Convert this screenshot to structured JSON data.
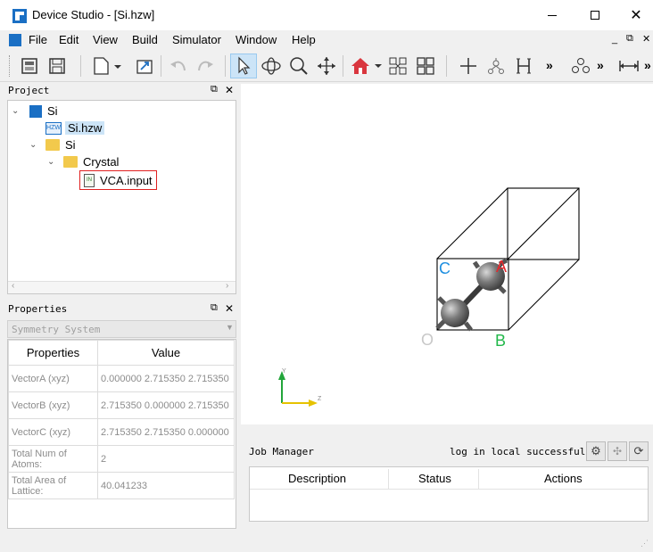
{
  "window": {
    "title": "Device Studio - [Si.hzw]"
  },
  "menu": [
    "File",
    "Edit",
    "View",
    "Build",
    "Simulator",
    "Window",
    "Help"
  ],
  "toolbar": {
    "icons": [
      "new-project-icon",
      "save-icon",
      "new-file-icon",
      "import-icon",
      "undo-icon",
      "redo-icon",
      "select-arrow-icon",
      "rotate-icon",
      "zoom-icon",
      "pan-icon",
      "home-icon",
      "fit-icon",
      "grid-icon",
      "add-atom-icon",
      "build-molecule-icon",
      "add-hydrogen-icon",
      "more-icon",
      "cluster-icon",
      "more-icon-2",
      "measure-icon"
    ]
  },
  "project_panel": {
    "title": "Project",
    "tree": [
      {
        "label": "Si",
        "icon": "device-project-icon",
        "level": 0,
        "expander": "v"
      },
      {
        "label": "Si.hzw",
        "icon": "hzw-file-icon",
        "level": 1,
        "selected": true
      },
      {
        "label": "Si",
        "icon": "folder-icon",
        "level": 1,
        "expander": "v"
      },
      {
        "label": "Crystal",
        "icon": "folder-icon",
        "level": 2,
        "expander": "v"
      },
      {
        "label": "VCA.input",
        "icon": "input-file-icon",
        "level": 3,
        "highlighted": true
      }
    ]
  },
  "properties_panel": {
    "title": "Properties",
    "dropdown": "Symmetry System",
    "headers": [
      "Properties",
      "Value"
    ],
    "rows": [
      {
        "name": "VectorA (xyz)",
        "value": "0.000000 2.715350 2.715350"
      },
      {
        "name": "VectorB (xyz)",
        "value": "2.715350 0.000000 2.715350"
      },
      {
        "name": "VectorC (xyz)",
        "value": "2.715350 2.715350 0.000000"
      },
      {
        "name": "Total Num of Atoms:",
        "value": "2"
      },
      {
        "name": "Total Area of Lattice:",
        "value": "40.041233"
      }
    ]
  },
  "viewport": {
    "axis_labels": {
      "a": "A",
      "b": "B",
      "c": "C",
      "origin": "O"
    },
    "axis_colors": {
      "a": "#e8262a",
      "b": "#22b84a",
      "c": "#1f8fe0",
      "origin": "#c8c8c8"
    },
    "triad": {
      "y": "Y",
      "z": "Z"
    }
  },
  "job_manager": {
    "title": "Job Manager",
    "status": "log in local successfully",
    "headers": [
      "Description",
      "Status",
      "Actions"
    ]
  }
}
